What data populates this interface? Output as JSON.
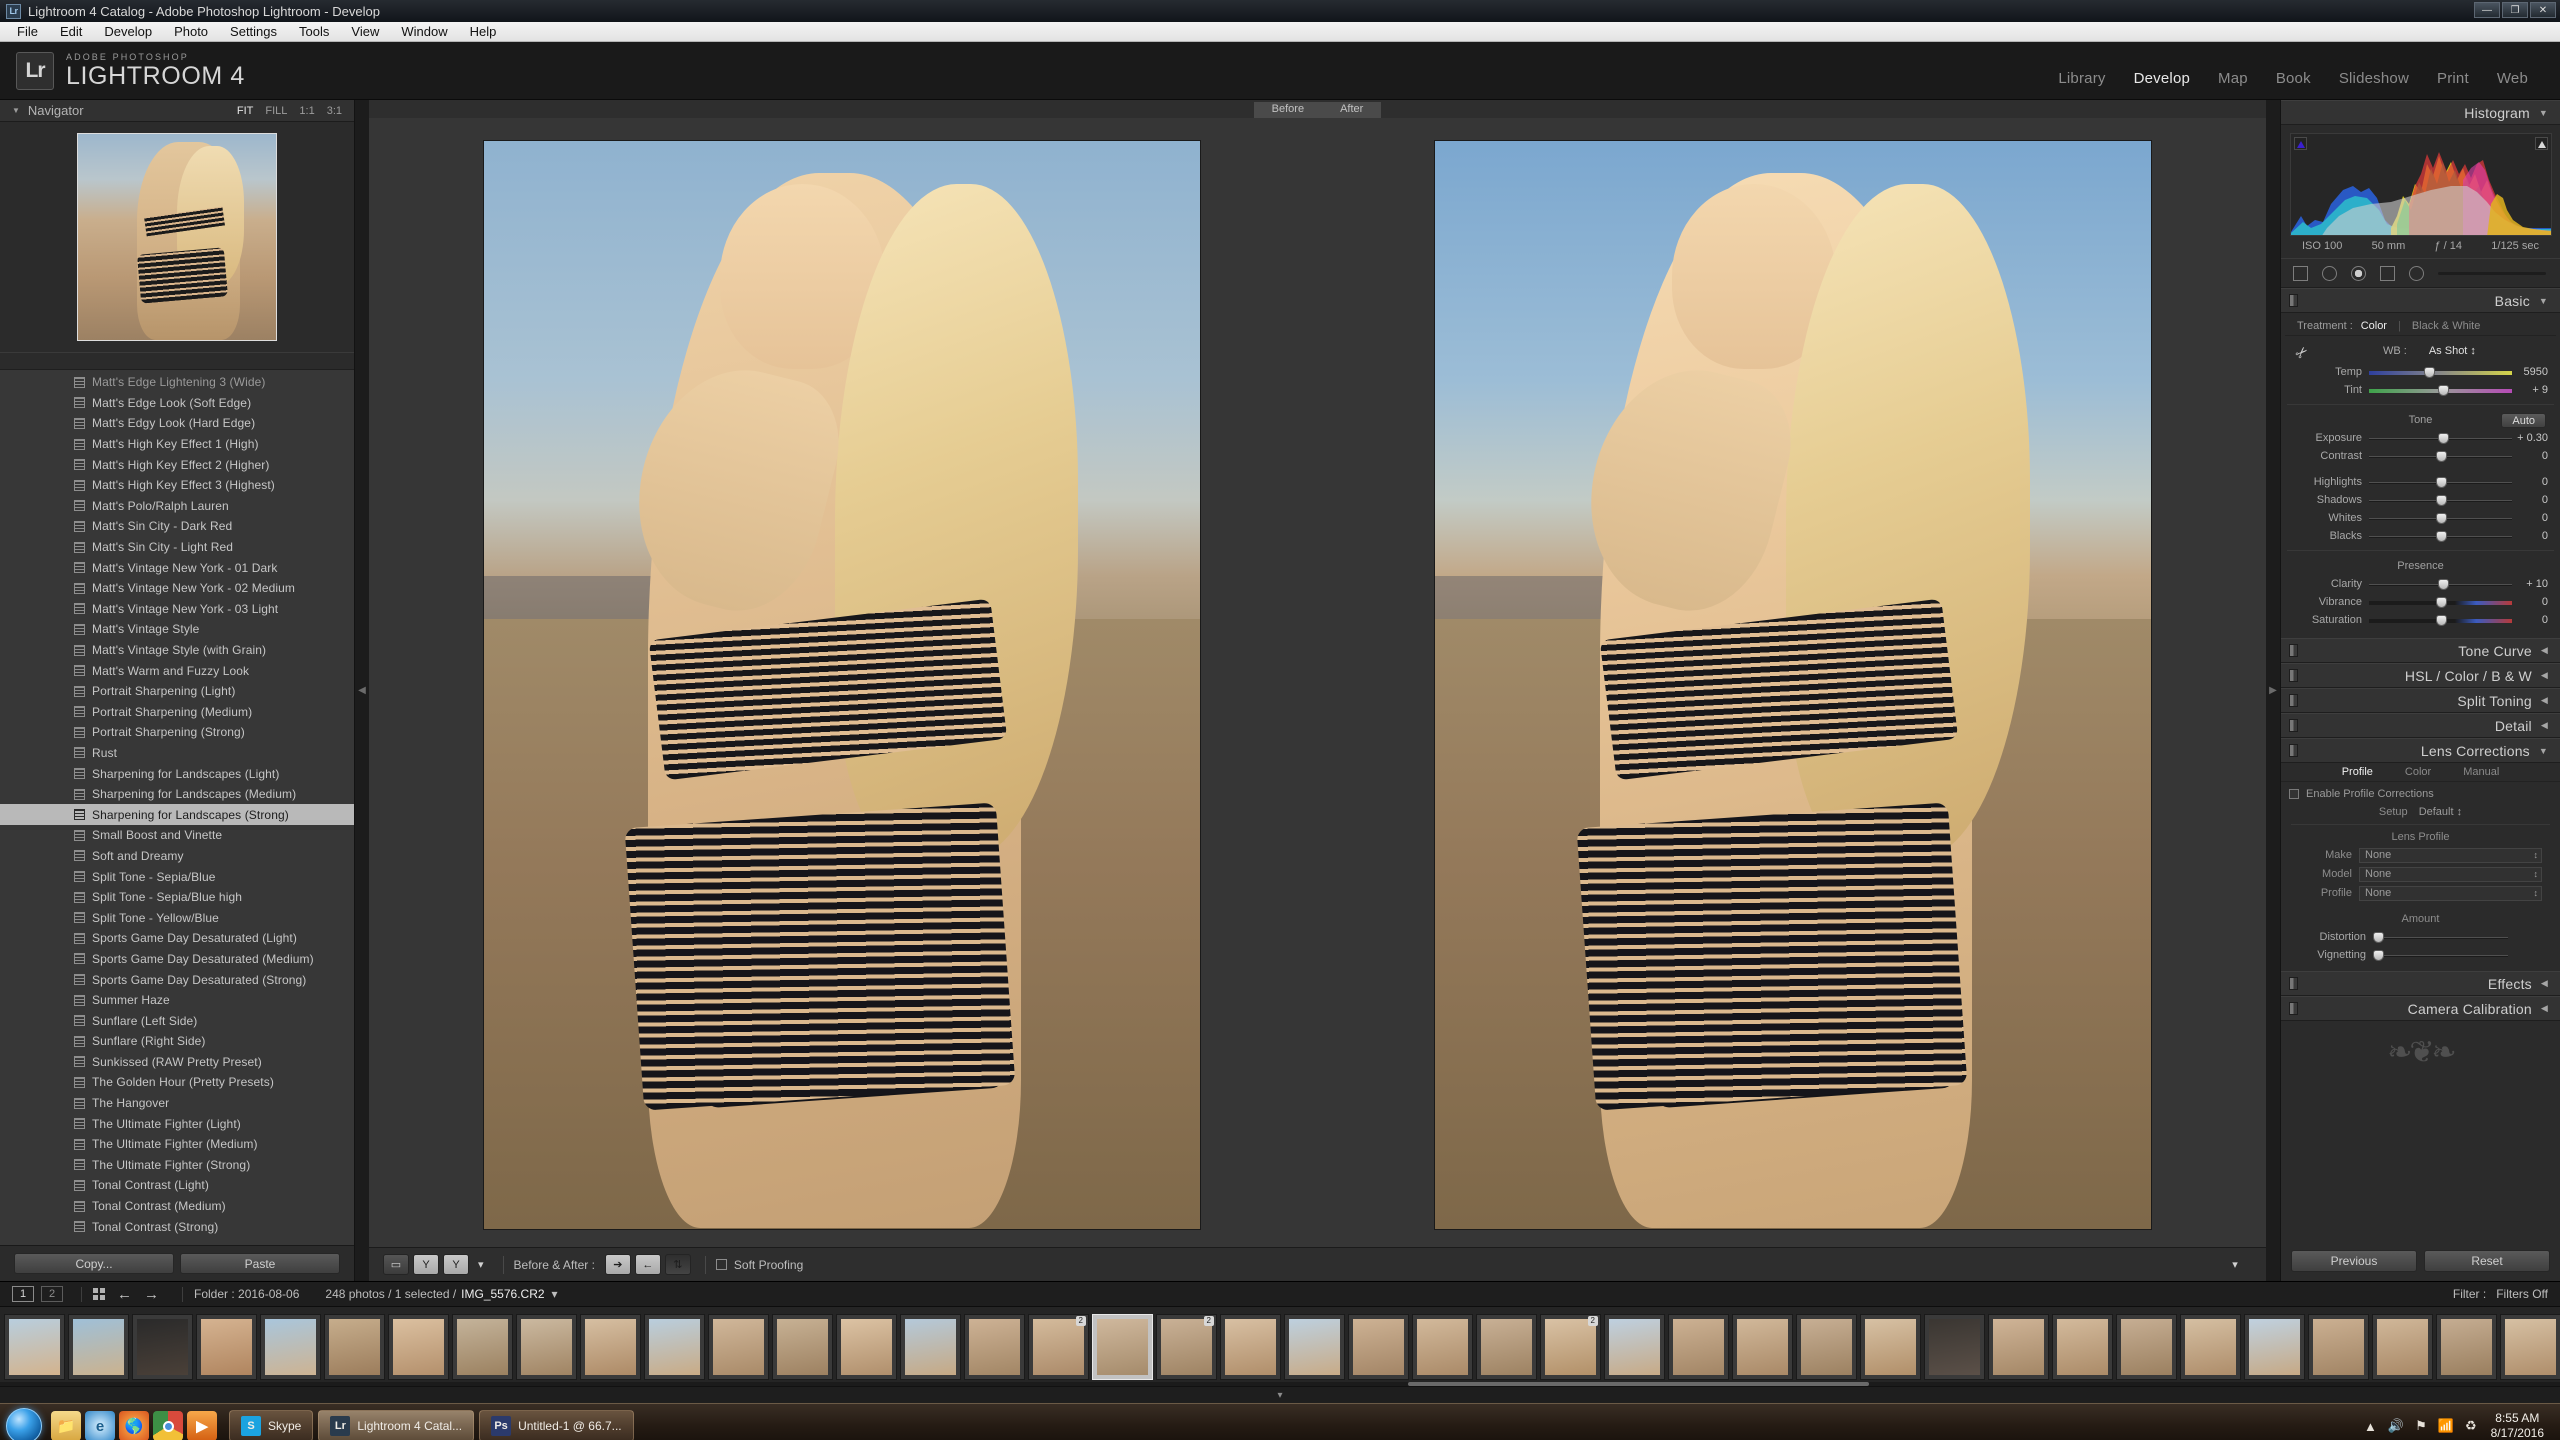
{
  "window": {
    "title": "Lightroom 4 Catalog - Adobe Photoshop Lightroom - Develop",
    "app_icon": "Lr",
    "minimize": "—",
    "maximize": "❐",
    "close": "✕"
  },
  "menubar": {
    "items": [
      "File",
      "Edit",
      "Develop",
      "Photo",
      "Settings",
      "Tools",
      "View",
      "Window",
      "Help"
    ]
  },
  "identity": {
    "logo": "Lr",
    "line1": "ADOBE PHOTOSHOP",
    "line2": "LIGHTROOM 4",
    "modules": [
      {
        "label": "Library",
        "active": false
      },
      {
        "label": "Develop",
        "active": true
      },
      {
        "label": "Map",
        "active": false
      },
      {
        "label": "Book",
        "active": false
      },
      {
        "label": "Slideshow",
        "active": false
      },
      {
        "label": "Print",
        "active": false
      },
      {
        "label": "Web",
        "active": false
      }
    ]
  },
  "navigator": {
    "title": "Navigator",
    "triangle": "▼",
    "zoom_levels": [
      "FIT",
      "FILL",
      "1:1",
      "3:1"
    ],
    "active_zoom": "FIT"
  },
  "presets": {
    "selected": "Sharpening for Landscapes (Strong)",
    "items": [
      {
        "label": "Matt's Edge Lightening 3 (Wide)",
        "faded": true
      },
      {
        "label": "Matt's Edge Look (Soft Edge)",
        "faded": false
      },
      {
        "label": "Matt's Edgy Look (Hard Edge)",
        "faded": false
      },
      {
        "label": "Matt's High Key Effect 1 (High)",
        "faded": false
      },
      {
        "label": "Matt's High Key Effect 2 (Higher)",
        "faded": false
      },
      {
        "label": "Matt's High Key Effect 3 (Highest)",
        "faded": false
      },
      {
        "label": "Matt's Polo/Ralph Lauren",
        "faded": false
      },
      {
        "label": "Matt's Sin City - Dark Red",
        "faded": false
      },
      {
        "label": "Matt's Sin City - Light Red",
        "faded": false
      },
      {
        "label": "Matt's Vintage New York - 01 Dark",
        "faded": false
      },
      {
        "label": "Matt's Vintage New York - 02 Medium",
        "faded": false
      },
      {
        "label": "Matt's Vintage New York - 03 Light",
        "faded": false
      },
      {
        "label": "Matt's Vintage Style",
        "faded": false
      },
      {
        "label": "Matt's Vintage Style (with Grain)",
        "faded": false
      },
      {
        "label": "Matt's Warm and Fuzzy Look",
        "faded": false
      },
      {
        "label": "Portrait Sharpening (Light)",
        "faded": false
      },
      {
        "label": "Portrait Sharpening (Medium)",
        "faded": false
      },
      {
        "label": "Portrait Sharpening (Strong)",
        "faded": false
      },
      {
        "label": "Rust",
        "faded": false
      },
      {
        "label": "Sharpening for Landscapes (Light)",
        "faded": false
      },
      {
        "label": "Sharpening for Landscapes (Medium)",
        "faded": false
      },
      {
        "label": "Sharpening for Landscapes (Strong)",
        "faded": false
      },
      {
        "label": "Small Boost and Vinette",
        "faded": false
      },
      {
        "label": "Soft and Dreamy",
        "faded": false
      },
      {
        "label": "Split Tone - Sepia/Blue",
        "faded": false
      },
      {
        "label": "Split Tone - Sepia/Blue high",
        "faded": false
      },
      {
        "label": "Split Tone - Yellow/Blue",
        "faded": false
      },
      {
        "label": "Sports Game Day Desaturated (Light)",
        "faded": false
      },
      {
        "label": "Sports Game Day Desaturated (Medium)",
        "faded": false
      },
      {
        "label": "Sports Game Day Desaturated (Strong)",
        "faded": false
      },
      {
        "label": "Summer Haze",
        "faded": false
      },
      {
        "label": "Sunflare (Left Side)",
        "faded": false
      },
      {
        "label": "Sunflare (Right Side)",
        "faded": false
      },
      {
        "label": "Sunkissed (RAW Pretty Preset)",
        "faded": false
      },
      {
        "label": "The Golden Hour (Pretty Presets)",
        "faded": false
      },
      {
        "label": "The Hangover",
        "faded": false
      },
      {
        "label": "The Ultimate Fighter (Light)",
        "faded": false
      },
      {
        "label": "The Ultimate Fighter (Medium)",
        "faded": false
      },
      {
        "label": "The Ultimate Fighter (Strong)",
        "faded": false
      },
      {
        "label": "Tonal Contrast (Light)",
        "faded": false
      },
      {
        "label": "Tonal Contrast (Medium)",
        "faded": false
      },
      {
        "label": "Tonal Contrast (Strong)",
        "faded": false
      }
    ],
    "copy_label": "Copy...",
    "paste_label": "Paste"
  },
  "preview": {
    "before_label": "Before",
    "after_label": "After"
  },
  "toolbar": {
    "before_after_label": "Before & After :",
    "soft_proofing_label": "Soft Proofing",
    "copy_settings_right": "➔",
    "copy_settings_left": "←",
    "swap_settings": "⇅",
    "loupe_icon": "▭",
    "flag_y1": "Y",
    "flag_y2": "Y",
    "chevron": "▾"
  },
  "histogram": {
    "title": "Histogram",
    "arrow": "▼",
    "iso": "ISO 100",
    "focal": "50 mm",
    "aperture": "ƒ / 14",
    "shutter": "1/125 sec"
  },
  "basic": {
    "title": "Basic",
    "arrow": "▼",
    "treatment_label": "Treatment :",
    "treatment_color": "Color",
    "treatment_bw": "Black & White",
    "wb_label": "WB :",
    "wb_value": "As Shot ↕",
    "tone_label": "Tone",
    "auto_label": "Auto",
    "presence_label": "Presence",
    "sliders": [
      {
        "name": "Temp",
        "value": "5950",
        "pos": 42,
        "style": "temp"
      },
      {
        "name": "Tint",
        "value": "+ 9",
        "pos": 52,
        "style": "tint"
      },
      {
        "name": "Exposure",
        "value": "+ 0.30",
        "pos": 52,
        "style": ""
      },
      {
        "name": "Contrast",
        "value": "0",
        "pos": 50,
        "style": ""
      },
      {
        "name": "Highlights",
        "value": "0",
        "pos": 50,
        "style": ""
      },
      {
        "name": "Shadows",
        "value": "0",
        "pos": 50,
        "style": ""
      },
      {
        "name": "Whites",
        "value": "0",
        "pos": 50,
        "style": ""
      },
      {
        "name": "Blacks",
        "value": "0",
        "pos": 50,
        "style": ""
      },
      {
        "name": "Clarity",
        "value": "+ 10",
        "pos": 52,
        "style": ""
      },
      {
        "name": "Vibrance",
        "value": "0",
        "pos": 50,
        "style": "vib"
      },
      {
        "name": "Saturation",
        "value": "0",
        "pos": 50,
        "style": "vib"
      }
    ]
  },
  "sections": [
    {
      "title": "Tone Curve",
      "arrow": "◀"
    },
    {
      "title": "HSL / Color / B & W",
      "arrow": "◀"
    },
    {
      "title": "Split Toning",
      "arrow": "◀"
    },
    {
      "title": "Detail",
      "arrow": "◀"
    }
  ],
  "lens": {
    "title": "Lens Corrections",
    "arrow": "▼",
    "tabs": [
      {
        "label": "Profile",
        "active": true
      },
      {
        "label": "Color",
        "active": false
      },
      {
        "label": "Manual",
        "active": false
      }
    ],
    "enable_label": "Enable Profile Corrections",
    "setup_label": "Setup",
    "setup_value": "Default ↕",
    "lens_profile_label": "Lens Profile",
    "fields": [
      {
        "label": "Make",
        "value": "None"
      },
      {
        "label": "Model",
        "value": "None"
      },
      {
        "label": "Profile",
        "value": "None"
      }
    ],
    "amount_label": "Amount",
    "amount_sliders": [
      {
        "name": "Distortion",
        "pos": 4
      },
      {
        "name": "Vignetting",
        "pos": 4
      }
    ]
  },
  "sections2": [
    {
      "title": "Effects",
      "arrow": "◀"
    },
    {
      "title": "Camera Calibration",
      "arrow": "◀"
    }
  ],
  "right_footer": {
    "previous": "Previous",
    "reset": "Reset"
  },
  "filmstrip_bar": {
    "page1": "1",
    "page2": "2",
    "grid_icon": "grid-icon",
    "back_arrow": "←",
    "fwd_arrow": "→",
    "folder": "Folder : 2016-08-06",
    "count": "248 photos / 1 selected /",
    "filename": "IMG_5576.CR2",
    "dropdown": "▾",
    "filter_label": "Filter :",
    "filter_value": "Filters Off"
  },
  "filmstrip": {
    "selected_index": 17,
    "thumbs": [
      {
        "badge": ""
      },
      {
        "badge": ""
      },
      {
        "badge": ""
      },
      {
        "badge": ""
      },
      {
        "badge": ""
      },
      {
        "badge": ""
      },
      {
        "badge": ""
      },
      {
        "badge": ""
      },
      {
        "badge": ""
      },
      {
        "badge": ""
      },
      {
        "badge": ""
      },
      {
        "badge": ""
      },
      {
        "badge": ""
      },
      {
        "badge": ""
      },
      {
        "badge": ""
      },
      {
        "badge": ""
      },
      {
        "badge": "2"
      },
      {
        "badge": ""
      },
      {
        "badge": "2"
      },
      {
        "badge": ""
      },
      {
        "badge": ""
      },
      {
        "badge": ""
      },
      {
        "badge": ""
      },
      {
        "badge": ""
      },
      {
        "badge": "2"
      },
      {
        "badge": ""
      },
      {
        "badge": ""
      },
      {
        "badge": ""
      },
      {
        "badge": ""
      },
      {
        "badge": ""
      },
      {
        "badge": ""
      },
      {
        "badge": ""
      },
      {
        "badge": ""
      },
      {
        "badge": ""
      },
      {
        "badge": ""
      },
      {
        "badge": ""
      },
      {
        "badge": ""
      },
      {
        "badge": ""
      },
      {
        "badge": ""
      },
      {
        "badge": ""
      }
    ],
    "collapse_arrow": "▾"
  },
  "taskbar": {
    "start": "start-orb",
    "quick_icons": [
      "explorer-icon",
      "internet-explorer-icon",
      "firefox-icon",
      "chrome-icon",
      "media-player-icon"
    ],
    "items": [
      {
        "icon": "S",
        "label": "Skype",
        "active": false,
        "color": "#1ba3e0"
      },
      {
        "icon": "Lr",
        "label": "Lightroom 4 Catal...",
        "active": true,
        "color": "#2a3b4d"
      },
      {
        "icon": "Ps",
        "label": "Untitled-1 @ 66.7...",
        "active": false,
        "color": "#2b3a6b"
      }
    ],
    "tray": [
      "▲",
      "🔊",
      "⚑",
      "📶",
      "♻"
    ],
    "time": "8:55 AM",
    "date": "8/17/2016"
  }
}
